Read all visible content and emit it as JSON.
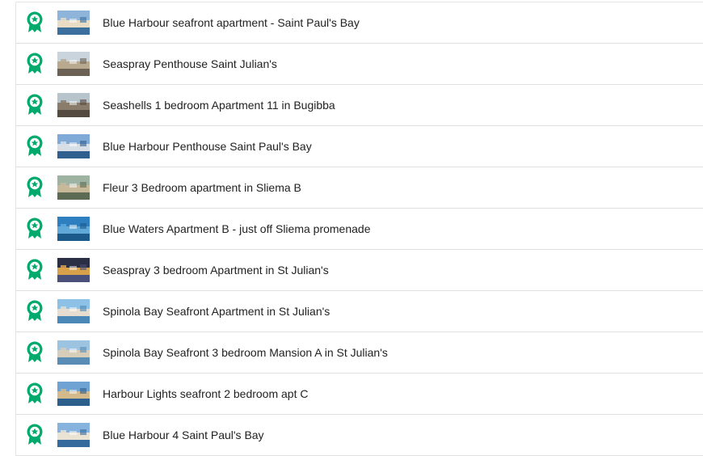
{
  "award_icon": "award-ribbon-icon",
  "colors": {
    "award": "#00aa6c",
    "text": "#222222",
    "divider": "#e0e0e0"
  },
  "listings": [
    {
      "title": "Blue Harbour seafront apartment - Saint Paul's Bay",
      "thumb": "harbour-photo",
      "palette": [
        "#8fb4d9",
        "#e8dcc4",
        "#3a6f9e"
      ]
    },
    {
      "title": "Seaspray Penthouse Saint Julian's",
      "thumb": "terrace-photo",
      "palette": [
        "#c9d4dc",
        "#b8a98f",
        "#6b6255"
      ]
    },
    {
      "title": "Seashells 1 bedroom Apartment 11 in Bugibba",
      "thumb": "interior-photo",
      "palette": [
        "#b7c4cc",
        "#8a7c6a",
        "#544a3f"
      ]
    },
    {
      "title": "Blue Harbour Penthouse Saint Paul's Bay",
      "thumb": "harbour-photo",
      "palette": [
        "#7fa9d6",
        "#d8dee6",
        "#2f5f8f"
      ]
    },
    {
      "title": "Fleur 3 Bedroom apartment in Sliema B",
      "thumb": "street-photo",
      "palette": [
        "#9eb3a2",
        "#c7b89a",
        "#5d6b55"
      ]
    },
    {
      "title": "Blue Waters Apartment B - just off Sliema promenade",
      "thumb": "sea-photo",
      "palette": [
        "#2e7fc0",
        "#5fa8d8",
        "#1c5a8c"
      ]
    },
    {
      "title": "Seaspray 3 bedroom Apartment in St Julian's",
      "thumb": "night-photo",
      "palette": [
        "#2b2f45",
        "#d9a14a",
        "#4a5078"
      ]
    },
    {
      "title": "Spinola Bay Seafront Apartment in St Julian's",
      "thumb": "bay-photo",
      "palette": [
        "#8ec1e6",
        "#e6ddd0",
        "#4b88b8"
      ]
    },
    {
      "title": "Spinola Bay Seafront 3 bedroom Mansion A in St Julian's",
      "thumb": "bay-photo",
      "palette": [
        "#9cc4e0",
        "#d8cdb8",
        "#5a8db5"
      ]
    },
    {
      "title": "Harbour Lights seafront 2 bedroom apt C",
      "thumb": "harbour-photo",
      "palette": [
        "#6fa3d4",
        "#d4b98a",
        "#2d5f8c"
      ]
    },
    {
      "title": "Blue Harbour 4 Saint Paul's Bay",
      "thumb": "harbour-photo",
      "palette": [
        "#86b3de",
        "#eae2d2",
        "#356b9c"
      ]
    }
  ]
}
